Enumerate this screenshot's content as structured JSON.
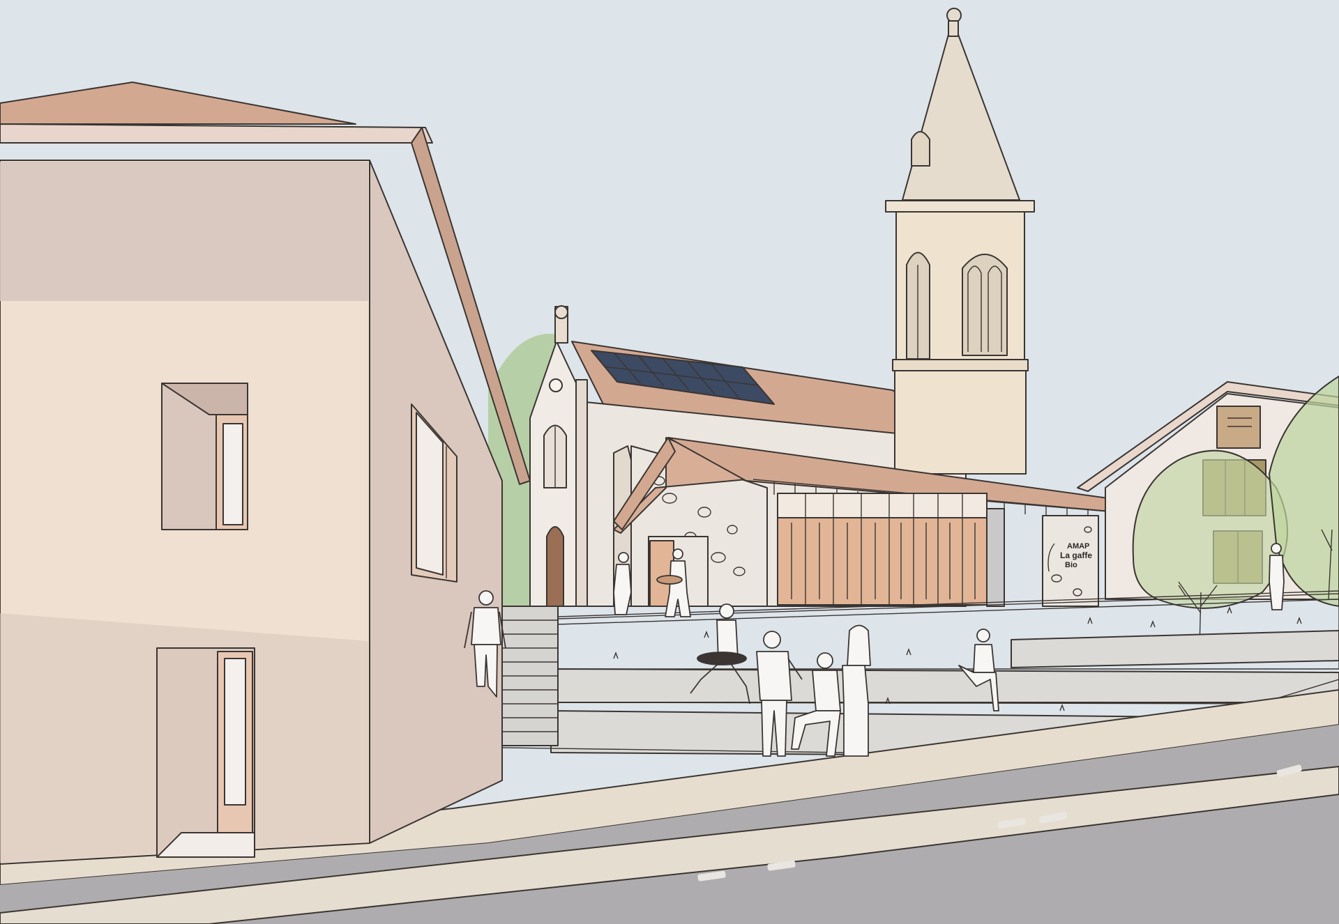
{
  "sign": {
    "line1": "AMAP",
    "line2": "La gaffe",
    "line3": "Bio"
  },
  "colors": {
    "sky": "#dde4ea",
    "roof": "#d3a891",
    "wall_light": "#efe0d2",
    "wall_shadow": "#d7c6bf",
    "stone": "#ece6e0",
    "tower": "#e8dccb",
    "grass": "#cfdcb8",
    "concrete": "#dcdad6",
    "road": "#aeacae",
    "plaza": "#ddd5bf",
    "wood": "#e1b596",
    "solar": "#3d4a63",
    "shutter": "#a89a68"
  },
  "people_count": 11
}
